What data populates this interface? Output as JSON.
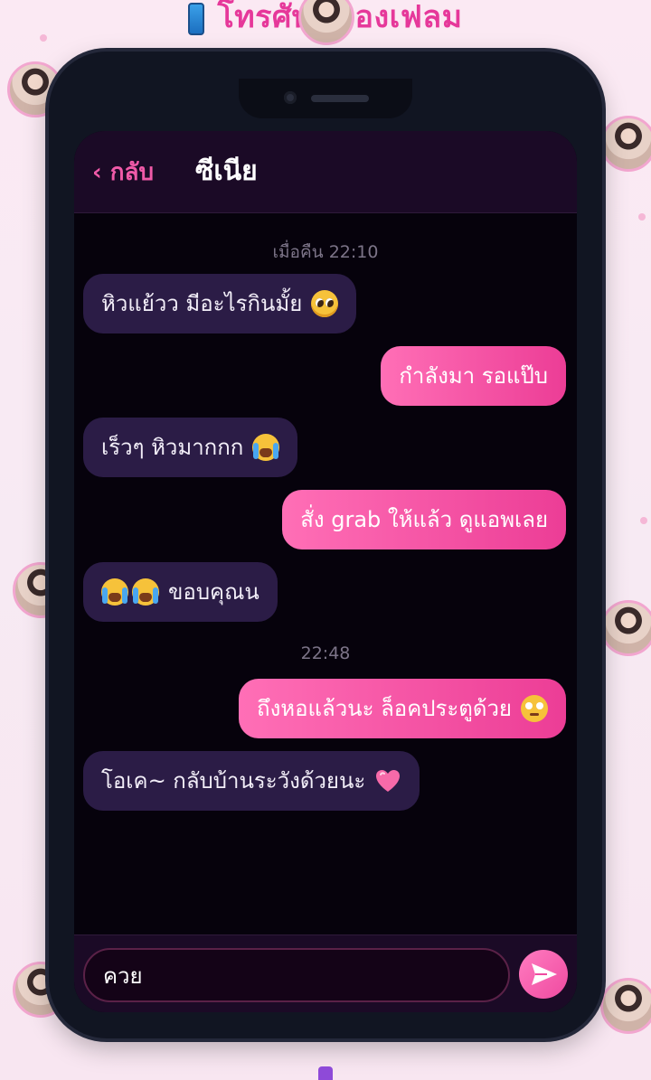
{
  "page": {
    "title": "โทรศัพท์ของเฟลม"
  },
  "header": {
    "back_label": "‹ กลับ",
    "contact_name": "ซีเนีย"
  },
  "messages": {
    "t1": "เมื่อคืน 22:10",
    "m1": "หิวแย้วว มีอะไรกินมั้ย",
    "m2": "กำลังมา รอแป๊บ",
    "m3": "เร็วๆ หิวมากกก",
    "m4": "สั่ง grab ให้แล้ว ดูแอพเลย",
    "m5": "ขอบคุณน",
    "t2": "22:48",
    "m6": "ถึงหอแล้วนะ ล็อคประตูด้วย",
    "m7": "โอเค~ กลับบ้านระวังด้วยนะ"
  },
  "input": {
    "value": "ควย"
  },
  "icons": {
    "phone": "mobile-phone-icon",
    "send": "send-icon",
    "pleading": "pleading-face-emoji",
    "crying": "loudly-crying-face-emoji",
    "eyeroll": "face-with-rolling-eyes-emoji",
    "heart": "pink-heart-emoji"
  },
  "colors": {
    "accent_pink": "#ec3d96",
    "incoming_bubble": "#2b1c46",
    "screen_bg": "#06020c",
    "header_bg": "#1b0a26"
  }
}
